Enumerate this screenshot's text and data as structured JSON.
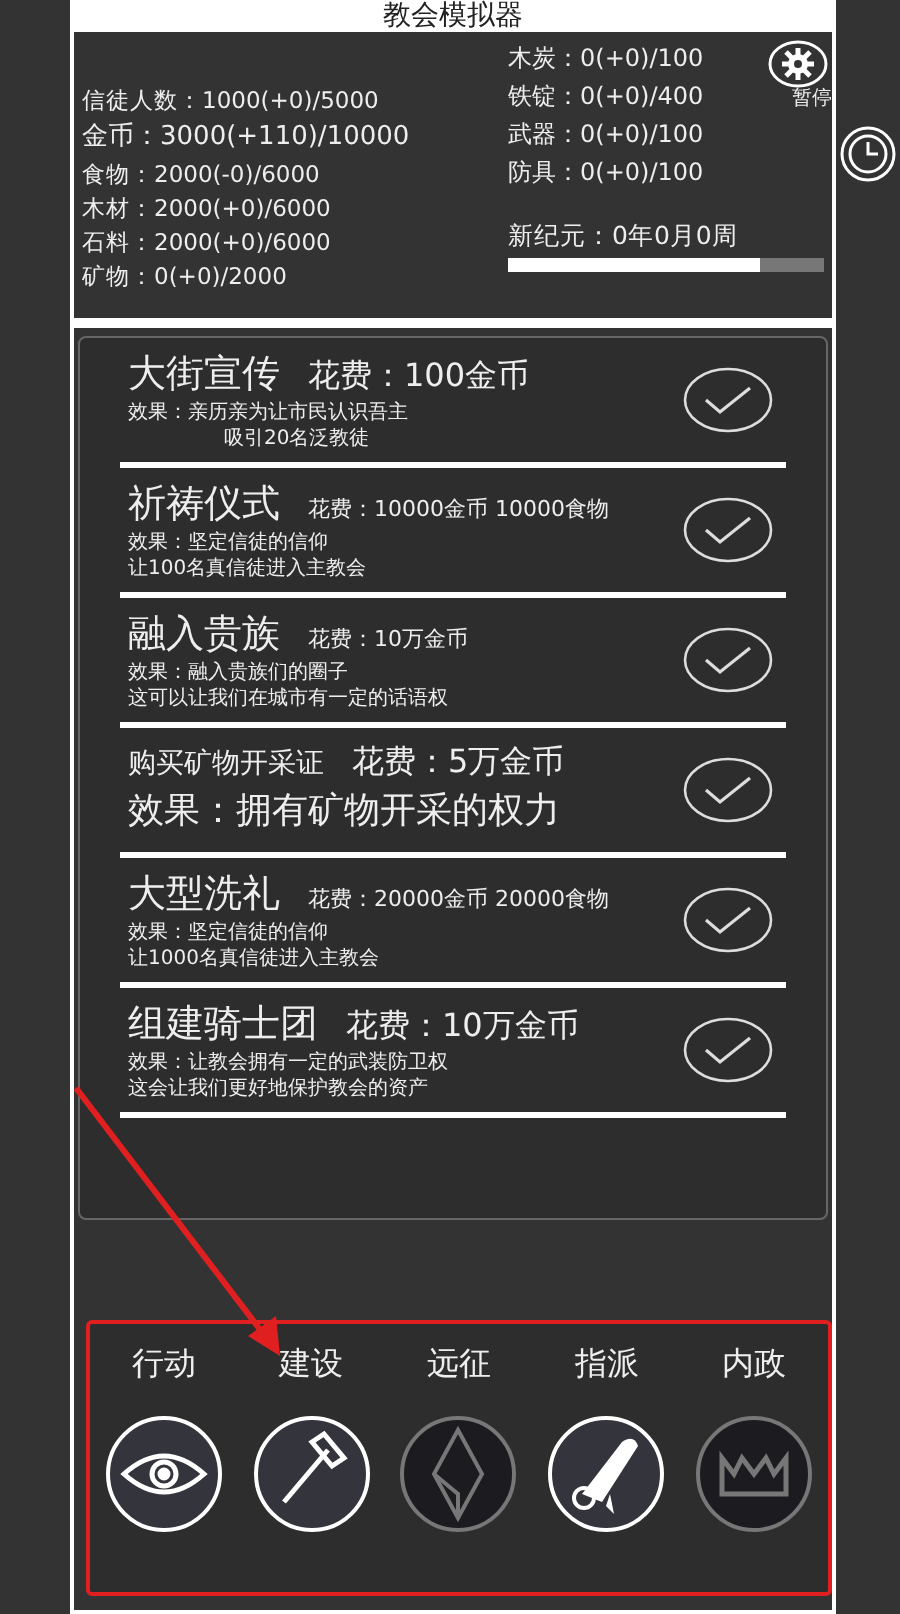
{
  "window": {
    "title": "教会模拟器"
  },
  "stats_left": [
    "信徒人数：1000(+0)/5000",
    "金币：3000(+110)/10000",
    "食物：2000(-0)/6000",
    "木材：2000(+0)/6000",
    "石料：2000(+0)/6000",
    "矿物：0(+0)/2000"
  ],
  "stats_right": [
    "木炭：0(+0)/100",
    "铁锭：0(+0)/400",
    "武器：0(+0)/100",
    "防具：0(+0)/100"
  ],
  "pause_label": "暂停",
  "era": {
    "label": "新纪元：0年0月0周",
    "level": 0.8
  },
  "actions": [
    {
      "kind": "large-cost",
      "title": "大街宣传",
      "cost": "花费：100金币",
      "effect": [
        "效果：亲历亲为让市民认识吾主",
        "吸引20名泛教徒"
      ]
    },
    {
      "kind": "small-cost",
      "title": "祈祷仪式",
      "cost": "花费：10000金币  10000食物",
      "effect": [
        "效果：坚定信徒的信仰",
        "让100名真信徒进入主教会"
      ]
    },
    {
      "kind": "small-cost",
      "title": "融入贵族",
      "cost": "花费：10万金币",
      "effect": [
        "效果：融入贵族们的圈子",
        "这可以让我们在城市有一定的话语权"
      ]
    },
    {
      "kind": "large-effect",
      "title": "购买矿物开采证",
      "cost": "花费：5万金币",
      "effect": [
        "效果：拥有矿物开采的权力"
      ]
    },
    {
      "kind": "small-cost",
      "title": "大型洗礼",
      "cost": "花费：20000金币  20000食物",
      "effect": [
        "效果：坚定信徒的信仰",
        "让1000名真信徒进入主教会"
      ]
    },
    {
      "kind": "large-cost",
      "title": "组建骑士团",
      "cost": "花费：10万金币",
      "effect": [
        "效果：让教会拥有一定的武装防卫权",
        "这会让我们更好地保护教会的资产"
      ]
    }
  ],
  "nav": [
    {
      "label": "行动",
      "kind": "eye",
      "locked": false
    },
    {
      "label": "建设",
      "kind": "hammer",
      "locked": false
    },
    {
      "label": "远征",
      "kind": "crystal",
      "locked": true
    },
    {
      "label": "指派",
      "kind": "scroll",
      "locked": false
    },
    {
      "label": "内政",
      "kind": "crown",
      "locked": true
    }
  ]
}
